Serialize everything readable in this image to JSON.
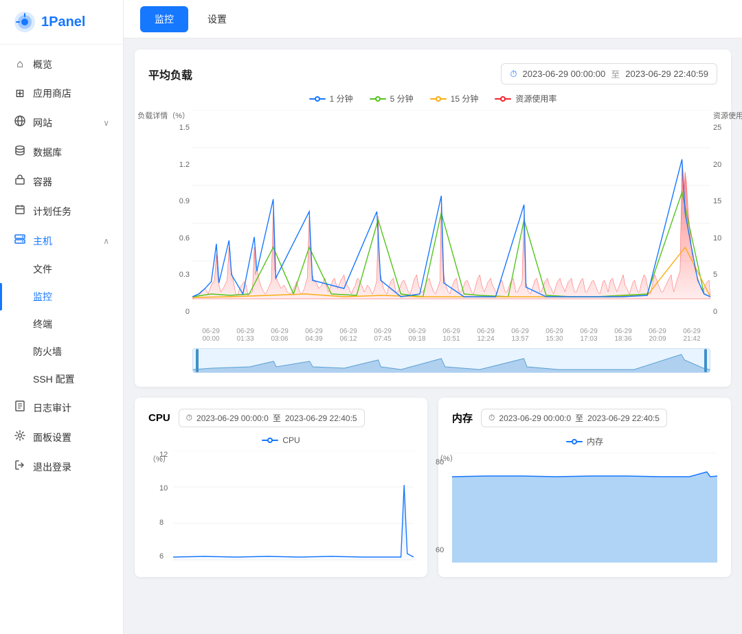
{
  "app": {
    "name": "1Panel"
  },
  "sidebar": {
    "items": [
      {
        "id": "overview",
        "label": "概览",
        "icon": "⌂",
        "active": false
      },
      {
        "id": "appstore",
        "label": "应用商店",
        "icon": "⊞",
        "active": false
      },
      {
        "id": "website",
        "label": "网站",
        "icon": "🌐",
        "active": false,
        "hasChildren": true,
        "expanded": false
      },
      {
        "id": "database",
        "label": "数据库",
        "icon": "◈",
        "active": false
      },
      {
        "id": "container",
        "label": "容器",
        "icon": "🚢",
        "active": false
      },
      {
        "id": "schedule",
        "label": "计划任务",
        "icon": "▦",
        "active": false
      },
      {
        "id": "host",
        "label": "主机",
        "icon": "目",
        "active": false,
        "hasChildren": true,
        "expanded": true
      },
      {
        "id": "files",
        "label": "文件",
        "sub": true,
        "active": false
      },
      {
        "id": "monitor",
        "label": "监控",
        "sub": true,
        "active": true
      },
      {
        "id": "terminal",
        "label": "终端",
        "sub": true,
        "active": false
      },
      {
        "id": "firewall",
        "label": "防火墙",
        "sub": true,
        "active": false
      },
      {
        "id": "ssh",
        "label": "SSH 配置",
        "sub": true,
        "active": false
      },
      {
        "id": "log",
        "label": "日志审计",
        "icon": "▦",
        "active": false
      },
      {
        "id": "panelset",
        "label": "面板设置",
        "icon": "⚙",
        "active": false
      },
      {
        "id": "logout",
        "label": "退出登录",
        "icon": "↪",
        "active": false
      }
    ]
  },
  "tabs": [
    {
      "id": "monitor",
      "label": "监控",
      "active": true
    },
    {
      "id": "settings",
      "label": "设置",
      "active": false
    }
  ],
  "avgLoad": {
    "title": "平均负载",
    "dateFrom": "2023-06-29 00:00:00",
    "dateTo": "2023-06-29 22:40:59",
    "legend": [
      {
        "label": "1 分钟",
        "color": "#1677ff"
      },
      {
        "label": "5 分钟",
        "color": "#52c41a"
      },
      {
        "label": "15 分钟",
        "color": "#faad14"
      },
      {
        "label": "资源使用率",
        "color": "#f5222d"
      }
    ],
    "yAxisLeft": "负载详情（%）",
    "yAxisRight": "资源使用率（%）",
    "yLeftValues": [
      "1.5",
      "1.2",
      "0.9",
      "0.6",
      "0.3",
      "0"
    ],
    "yRightValues": [
      "25",
      "20",
      "15",
      "10",
      "5",
      "0"
    ],
    "xLabels": [
      "06-29\n00:00",
      "06-29\n01:33",
      "06-29\n03:06",
      "06-29\n04:39",
      "06-29\n06:12",
      "06-29\n07:45",
      "06-29\n09:18",
      "06-29\n10:51",
      "06-29\n12:24",
      "06-29\n13:57",
      "06-29\n15:30",
      "06-29\n17:03",
      "06-29\n18:36",
      "06-29\n20:09",
      "06-29\n21:42"
    ]
  },
  "cpu": {
    "title": "CPU",
    "dateFrom": "2023-06-29 00:00:0",
    "dateTo": "2023-06-29 22:40:5",
    "legend": [
      {
        "label": "CPU",
        "color": "#1677ff"
      }
    ],
    "yAxisLabel": "（%）",
    "yValues": [
      "12",
      "10",
      "8",
      "6"
    ]
  },
  "memory": {
    "title": "内存",
    "dateFrom": "2023-06-29 00:00:0",
    "dateTo": "2023-06-29 22:40:5",
    "legend": [
      {
        "label": "内存",
        "color": "#1677ff"
      }
    ],
    "yAxisLabel": "（%）",
    "yValues": [
      "80",
      "60"
    ]
  }
}
